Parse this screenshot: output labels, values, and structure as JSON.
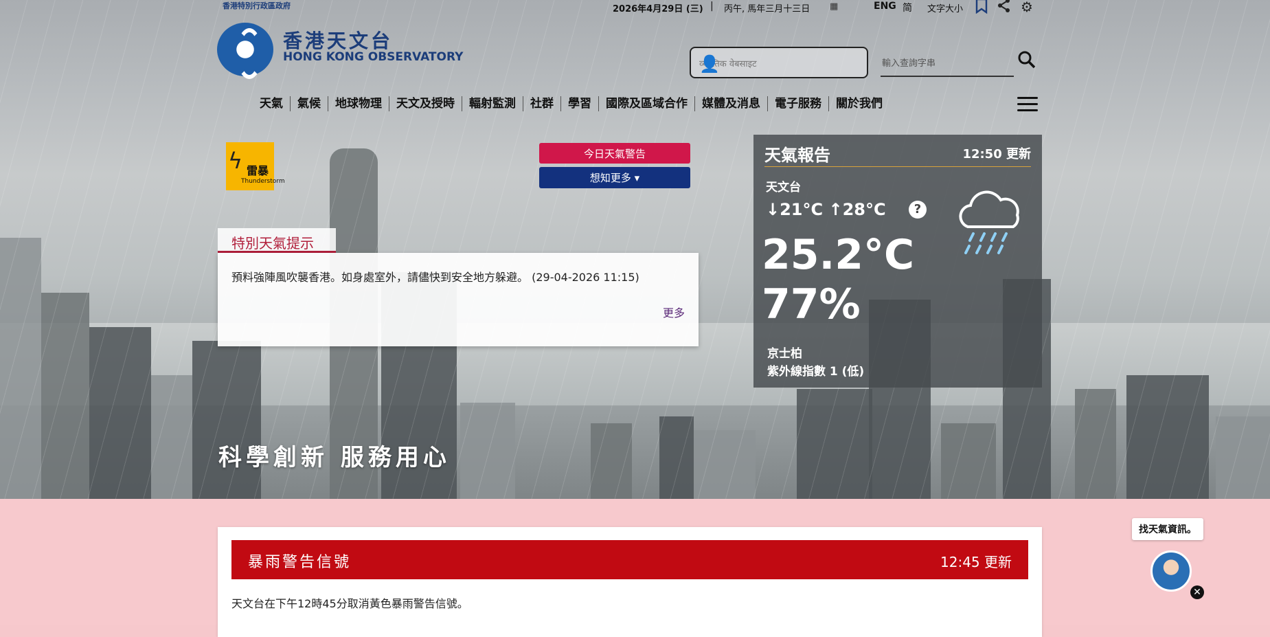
{
  "topbar": {
    "gov_name": "香港特別行政區政府",
    "date": "2026年4月29日 (三)",
    "separator": "|",
    "lunar_date": "丙午, 馬年三月十三日",
    "lang_eng": "ENG",
    "lang_simplified": "简",
    "font_size": "文字大小"
  },
  "brand": {
    "name_zh": "香港天文台",
    "name_en": "HONG KONG OBSERVATORY"
  },
  "search": {
    "voice_placeholder": "व्यक्तिक वेबसाइट",
    "query_placeholder": "輸入查詢字串"
  },
  "nav": {
    "items": [
      "天氣",
      "氣候",
      "地球物理",
      "天文及授時",
      "輻射監測",
      "社群",
      "學習",
      "國際及區域合作",
      "媒體及消息",
      "電子服務",
      "關於我們"
    ]
  },
  "warning_badge": {
    "label_zh": "雷暴",
    "label_en": "Thunderstorm",
    "color": "#f7b500"
  },
  "buttons": {
    "warnings_today": "今日天氣警告",
    "learn_more": "想知更多"
  },
  "special_tip": {
    "tab_label": "特別天氣提示",
    "text": "預料強陣風吹襲香港。如身處室外，請儘快到安全地方躲避。 (29-04-2026 11:15)",
    "more": "更多"
  },
  "slogan": "科學創新 服務用心",
  "weather_report": {
    "title": "天氣報告",
    "updated": "12:50 更新",
    "station": "天文台",
    "min_temp": "↓21°C",
    "max_temp": "↑28°C",
    "help": "?",
    "temperature": "25.2°C",
    "humidity": "77%",
    "district": "京士柏",
    "uv_index": "紫外線指數 1 (低)",
    "icon": "rain-cloud-icon"
  },
  "rain_warning": {
    "title": "暴雨警告信號",
    "updated": "12:45 更新",
    "text": "天文台在下午12時45分取消黃色暴雨警告信號。",
    "color": "#c10a12"
  },
  "chatbot": {
    "bubble": "找天氣資訊。",
    "close": "✕"
  }
}
